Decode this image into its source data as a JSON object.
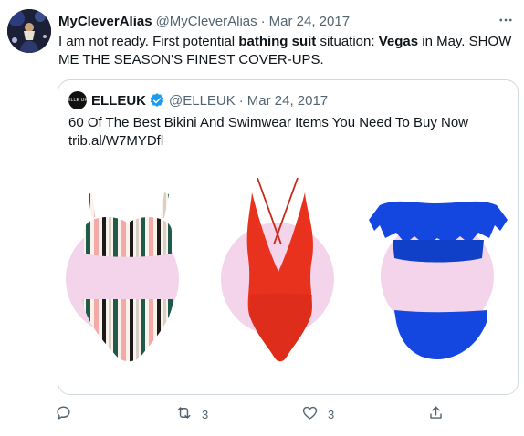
{
  "tweet": {
    "author_name": "MyCleverAlias",
    "author_handle": "@MyCleverAlias",
    "separator": "·",
    "date": "Mar 24, 2017",
    "text_parts": {
      "p1": "I am not ready. First potential ",
      "b1": "bathing suit",
      "p2": " situation: ",
      "b2": "Vegas",
      "p3": " in May. SHOW ME THE SEASON'S FINEST COVER-UPS."
    }
  },
  "quote": {
    "avatar_text": "ELLE UK",
    "author_name": "ELLEUK",
    "author_handle": "@ELLEUK",
    "separator": "·",
    "date": "Mar 24, 2017",
    "text": "60 Of The Best Bikini And Swimwear Items You Need To Buy Now",
    "link": "trib.al/W7MYDfl"
  },
  "actions": {
    "reply_count": "",
    "retweet_count": "3",
    "like_count": "3",
    "share_count": ""
  },
  "icons": {
    "more": "more-dots-icon",
    "verified": "verified-badge-icon",
    "reply": "reply-icon",
    "retweet": "retweet-icon",
    "like": "heart-icon",
    "share": "share-icon"
  },
  "colors": {
    "text": "#0f1419",
    "muted": "#536471",
    "border": "#cfd9de",
    "verified": "#1d9bf0",
    "circle": "#f3d4ea",
    "swim_red": "#e8321e",
    "swim_blue": "#1447e0",
    "stripe_green": "#1f5a4d",
    "stripe_pink": "#f4a9a8"
  }
}
